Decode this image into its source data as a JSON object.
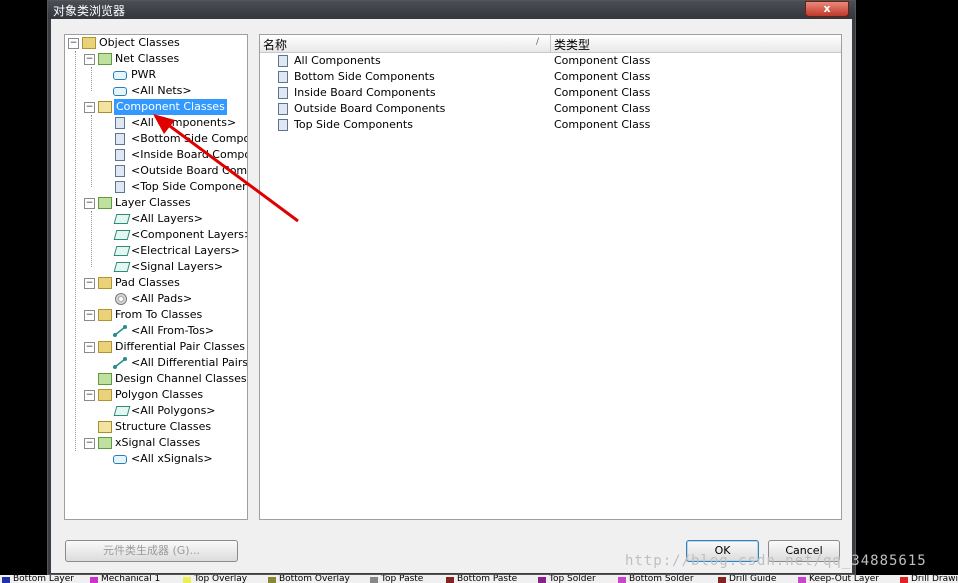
{
  "window": {
    "title": "对象类浏览器",
    "close_label": "x"
  },
  "tree": {
    "root": "Object Classes",
    "net_classes": "Net Classes",
    "net_items": [
      "PWR",
      "<All Nets>"
    ],
    "component_classes": "Component Classes",
    "component_items": [
      "<All Components>",
      "<Bottom Side Compor",
      "<Inside Board Compo",
      "<Outside Board Comp",
      "<Top Side Componen"
    ],
    "layer_classes": "Layer Classes",
    "layer_items": [
      "<All Layers>",
      "<Component Layers>",
      "<Electrical Layers>",
      "<Signal Layers>"
    ],
    "pad_classes": "Pad Classes",
    "pad_items": [
      "<All Pads>"
    ],
    "fromto_classes": "From To Classes",
    "fromto_items": [
      "<All From-Tos>"
    ],
    "diffpair_classes": "Differential Pair Classes",
    "diffpair_items": [
      "<All Differential Pairs>"
    ],
    "design_channel": "Design Channel Classes",
    "polygon_classes": "Polygon Classes",
    "polygon_items": [
      "<All Polygons>"
    ],
    "structure_classes": "Structure Classes",
    "xsignal_classes": "xSignal Classes",
    "xsignal_items": [
      "<All xSignals>"
    ]
  },
  "list": {
    "col_name": "名称",
    "col_type": "类类型",
    "sort_indicator": "/",
    "rows": [
      {
        "name": "All Components",
        "type": "Component Class"
      },
      {
        "name": "Bottom Side Components",
        "type": "Component Class"
      },
      {
        "name": "Inside Board Components",
        "type": "Component Class"
      },
      {
        "name": "Outside Board Components",
        "type": "Component Class"
      },
      {
        "name": "Top Side Components",
        "type": "Component Class"
      }
    ]
  },
  "buttons": {
    "generator": "元件类生成器 (G)...",
    "ok": "OK",
    "cancel": "Cancel"
  },
  "watermark": "http://blog.csdn.net/qq_34885615",
  "layer_tabs": [
    {
      "label": "Bottom Layer",
      "color": "#2233aa"
    },
    {
      "label": "Mechanical 1",
      "color": "#cc33cc"
    },
    {
      "label": "Top Overlay",
      "color": "#eeee55"
    },
    {
      "label": "Bottom Overlay",
      "color": "#888833"
    },
    {
      "label": "Top Paste",
      "color": "#888888"
    },
    {
      "label": "Bottom Paste",
      "color": "#882222"
    },
    {
      "label": "Top Solder",
      "color": "#882288"
    },
    {
      "label": "Bottom Solder",
      "color": "#cc44cc"
    },
    {
      "label": "Drill Guide",
      "color": "#882222"
    },
    {
      "label": "Keep-Out Layer",
      "color": "#cc44cc"
    },
    {
      "label": "Drill Drawing",
      "color": "#dd2222"
    }
  ],
  "colors": {
    "selection": "#3399ff",
    "arrow": "#e00000"
  }
}
